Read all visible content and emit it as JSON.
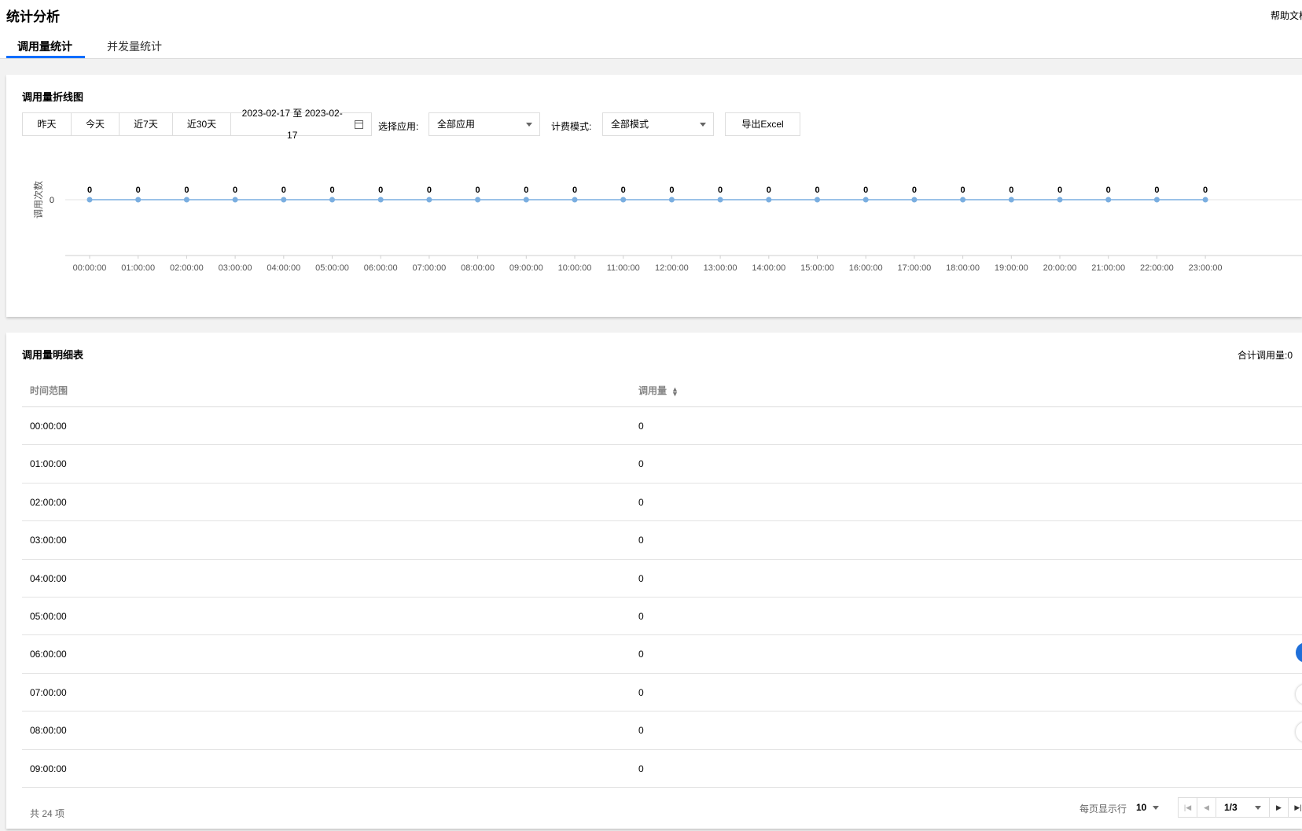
{
  "header": {
    "title": "统计分析",
    "help": "帮助文档",
    "tabs": [
      {
        "label": "调用量统计",
        "active": true
      },
      {
        "label": "并发量统计",
        "active": false
      }
    ]
  },
  "chart_card": {
    "title": "调用量折线图",
    "range_buttons": [
      "昨天",
      "今天",
      "近7天",
      "近30天"
    ],
    "date_range": "2023-02-17 至 2023-02-17",
    "calendar_icon": "calendar-icon",
    "app_label": "选择应用:",
    "app_value": "全部应用",
    "mode_label": "计费模式:",
    "mode_value": "全部模式",
    "export_label": "导出Excel"
  },
  "chart_data": {
    "type": "line",
    "ylabel": "调用次数",
    "y_ticks": [
      "0"
    ],
    "x": [
      "00:00:00",
      "01:00:00",
      "02:00:00",
      "03:00:00",
      "04:00:00",
      "05:00:00",
      "06:00:00",
      "07:00:00",
      "08:00:00",
      "09:00:00",
      "10:00:00",
      "11:00:00",
      "12:00:00",
      "13:00:00",
      "14:00:00",
      "15:00:00",
      "16:00:00",
      "17:00:00",
      "18:00:00",
      "19:00:00",
      "20:00:00",
      "21:00:00",
      "22:00:00",
      "23:00:00"
    ],
    "values": [
      0,
      0,
      0,
      0,
      0,
      0,
      0,
      0,
      0,
      0,
      0,
      0,
      0,
      0,
      0,
      0,
      0,
      0,
      0,
      0,
      0,
      0,
      0,
      0
    ],
    "line_color": "#7aaee0",
    "grid": false
  },
  "table_card": {
    "title": "调用量明细表",
    "total": "合计调用量:0",
    "columns": [
      "时间范围",
      "调用量"
    ],
    "sort_icon": "sort-icon",
    "rows": [
      {
        "time": "00:00:00",
        "count": "0"
      },
      {
        "time": "01:00:00",
        "count": "0"
      },
      {
        "time": "02:00:00",
        "count": "0"
      },
      {
        "time": "03:00:00",
        "count": "0"
      },
      {
        "time": "04:00:00",
        "count": "0"
      },
      {
        "time": "05:00:00",
        "count": "0"
      },
      {
        "time": "06:00:00",
        "count": "0"
      },
      {
        "time": "07:00:00",
        "count": "0"
      },
      {
        "time": "08:00:00",
        "count": "0"
      },
      {
        "time": "09:00:00",
        "count": "0"
      }
    ],
    "footer_count": "共 24 项",
    "page_size_label": "每页显示行",
    "page_size": "10",
    "page": "1/3"
  },
  "colors": {
    "accent": "#006eff",
    "float_button": "#1f6fd9"
  }
}
